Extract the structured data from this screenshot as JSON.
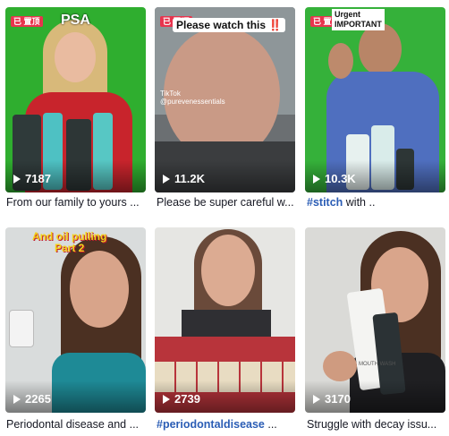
{
  "tiles": [
    {
      "views": "7187",
      "caption": "From our family to yours ...",
      "overlay": "PSA",
      "flag": "已 置顶"
    },
    {
      "views": "11.2K",
      "caption": "Please be super careful w...",
      "overlay": "Please watch this",
      "overlay_mark": "‼️",
      "flag": "已 置顶",
      "watermark": "TikTok",
      "watermark_user": "@purevenessentials"
    },
    {
      "views": "10.3K",
      "caption_tag": "#stitch",
      "caption_rest": " with ..",
      "overlay_line1": "Urgent",
      "overlay_line2": "IMPORTANT",
      "flag": "已 置顶"
    },
    {
      "views": "2265",
      "caption": "Periodontal disease and ...",
      "overlay_line1": "And oil pulling",
      "overlay_line2": "Part 2"
    },
    {
      "views": "2739",
      "caption_tag": "#periodontaldisease",
      "caption_rest": " ..."
    },
    {
      "views": "3170",
      "caption": "Struggle with decay issu...",
      "bottle_label": "MOUTH WASH"
    }
  ],
  "colors": {
    "caption_text": "#161823",
    "hashtag": "#2b5db5",
    "pinned_flag": "#e8344e",
    "green_screen": "#2fa52a"
  }
}
